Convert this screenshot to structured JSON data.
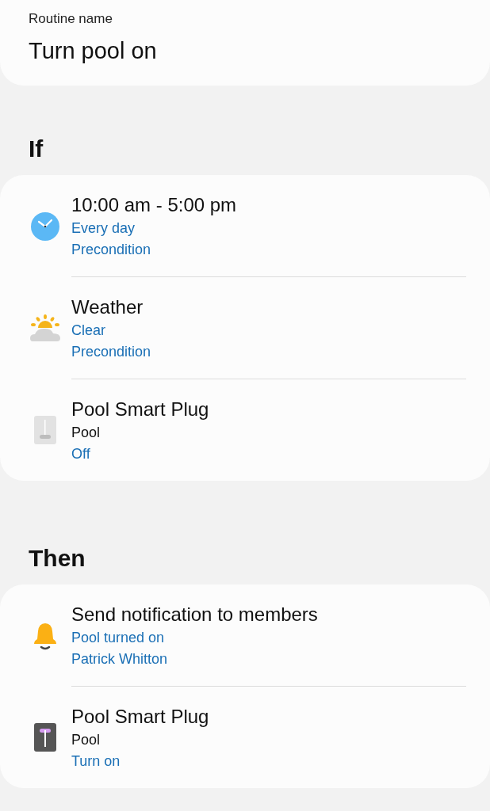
{
  "routine": {
    "label": "Routine name",
    "name": "Turn pool on"
  },
  "sections": [
    {
      "title": "If",
      "items": [
        {
          "kind": "clock",
          "title": "10:00 am - 5:00 pm",
          "lines": [
            {
              "text": "Every day",
              "kind": "accent"
            },
            {
              "text": "Precondition",
              "kind": "accent"
            }
          ]
        },
        {
          "kind": "weather",
          "title": "Weather",
          "lines": [
            {
              "text": "Clear",
              "kind": "accent"
            },
            {
              "text": "Precondition",
              "kind": "accent"
            }
          ]
        },
        {
          "kind": "plug",
          "on": false,
          "title": "Pool Smart Plug",
          "lines": [
            {
              "text": "Pool",
              "kind": "plain"
            },
            {
              "text": "Off",
              "kind": "accent"
            }
          ]
        }
      ]
    },
    {
      "title": "Then",
      "items": [
        {
          "kind": "bell",
          "title": "Send notification to members",
          "lines": [
            {
              "text": "Pool turned on",
              "kind": "accent"
            },
            {
              "text": "Patrick Whitton",
              "kind": "accent"
            }
          ]
        },
        {
          "kind": "plug",
          "on": true,
          "title": "Pool Smart Plug",
          "lines": [
            {
              "text": "Pool",
              "kind": "plain"
            },
            {
              "text": "Turn on",
              "kind": "accent"
            }
          ]
        }
      ]
    }
  ]
}
